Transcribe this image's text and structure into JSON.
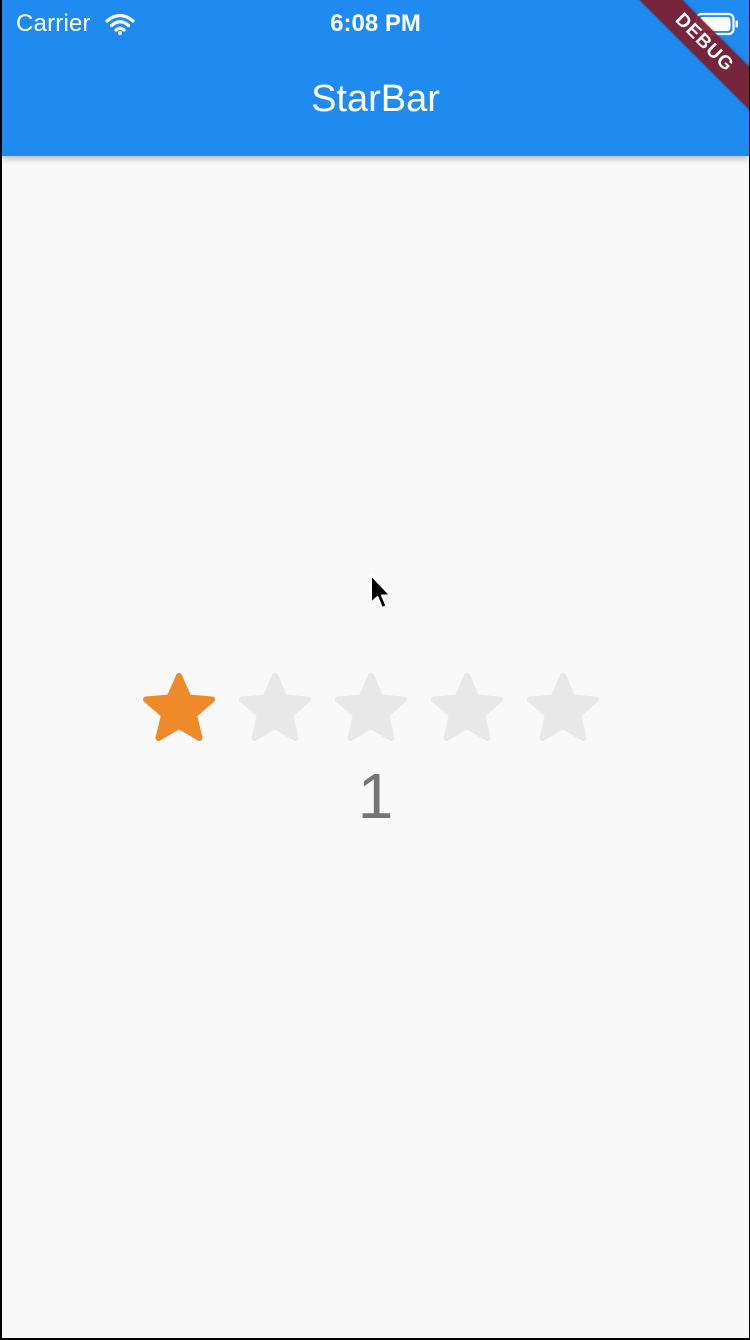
{
  "status_bar": {
    "carrier": "Carrier",
    "wifi_icon": "wifi-icon",
    "time": "6:08 PM",
    "battery_icon": "battery-icon"
  },
  "app_bar": {
    "title": "StarBar",
    "color": "#1f8bf0"
  },
  "debug_banner": {
    "label": "DEBUG",
    "color": "#801828"
  },
  "rating": {
    "max": 5,
    "value": 1,
    "display_value": "1",
    "filled_color": "#ee8a2a",
    "empty_color": "#e8e8e8",
    "star_icon": "star-icon"
  },
  "cursor": {
    "icon": "mouse-pointer-icon"
  }
}
